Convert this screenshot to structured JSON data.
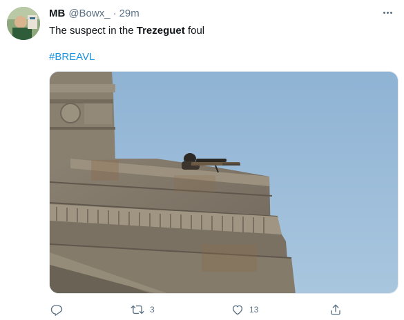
{
  "tweet": {
    "author_name": "MB",
    "author_handle": "@Bowx_",
    "separator": "·",
    "time": "29m",
    "text_before": "The suspect in the ",
    "text_bold": "Trezeguet",
    "text_after": " foul",
    "hashtag": "#BREAVL"
  },
  "actions": {
    "reply_count": "",
    "retweet_count": "3",
    "like_count": "13"
  },
  "icons": {
    "reply": "reply-icon",
    "retweet": "retweet-icon",
    "like": "heart-icon",
    "share": "share-icon",
    "more": "more-icon"
  },
  "colors": {
    "text": "#0f1419",
    "secondary": "#5b7083",
    "link": "#1b95e0",
    "sky": "#9dbcd8"
  }
}
